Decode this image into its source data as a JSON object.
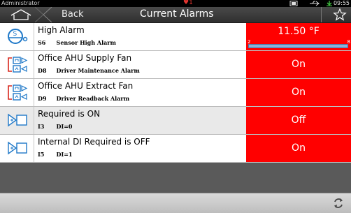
{
  "statusbar": {
    "user": "Administrator",
    "alert_count": "1",
    "time": "09:55"
  },
  "header": {
    "back_label": "Back",
    "title": "Current Alarms"
  },
  "alarms": [
    {
      "name": "High Alarm",
      "code": "S6",
      "desc": "Sensor High Alarm",
      "value": "11.50 °F",
      "icon": "sensor-icon",
      "bar": {
        "min": "2",
        "max": "8",
        "value_fraction": 0.99
      }
    },
    {
      "name": "Office AHU Supply Fan",
      "code": "D8",
      "desc": "Driver Maintenance Alarm",
      "value": "On",
      "icon": "driver-icon"
    },
    {
      "name": "Office AHU Extract Fan",
      "code": "D9",
      "desc": "Driver Readback Alarm",
      "value": "On",
      "icon": "driver-icon"
    },
    {
      "name": "Required is ON",
      "code": "I3",
      "desc": "DI=0",
      "value": "Off",
      "icon": "digital-input-icon"
    },
    {
      "name": "Internal DI Required is OFF",
      "code": "I5",
      "desc": "DI=1",
      "value": "On",
      "icon": "digital-input-icon"
    }
  ],
  "colors": {
    "alarm_red": "#ff0000",
    "icon_blue": "#1e78c8",
    "icon_red": "#d9261c"
  }
}
